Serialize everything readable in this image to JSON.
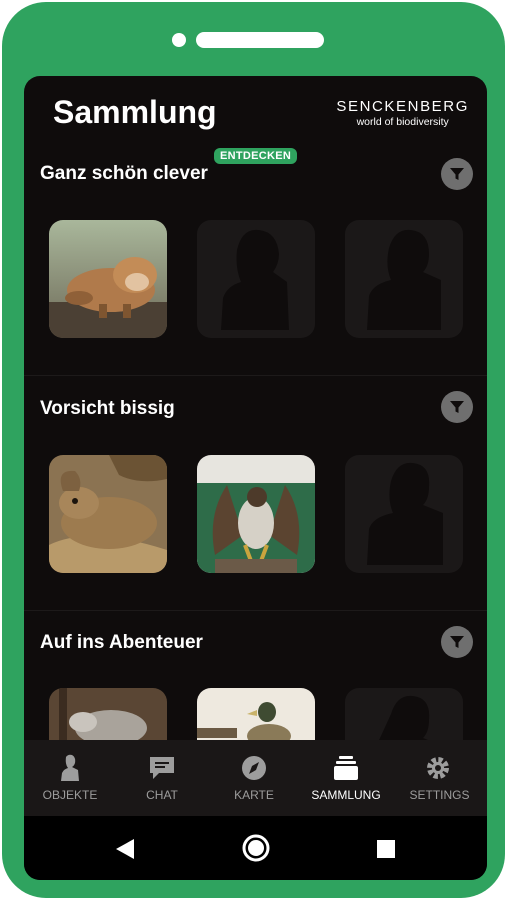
{
  "app": {
    "title": "Sammlung",
    "logo_main": "SENCKENBERG",
    "logo_sub": "world of biodiversity"
  },
  "sections": [
    {
      "title": "Ganz schön clever",
      "badge": "ENTDECKEN"
    },
    {
      "title": "Vorsicht bissig"
    },
    {
      "title": "Auf ins Abenteuer"
    }
  ],
  "nav": {
    "items": [
      {
        "label": "OBJEKTE",
        "icon": "person-icon"
      },
      {
        "label": "CHAT",
        "icon": "chat-icon"
      },
      {
        "label": "KARTE",
        "icon": "compass-icon"
      },
      {
        "label": "SAMMLUNG",
        "icon": "collection-icon"
      },
      {
        "label": "SETTINGS",
        "icon": "gear-icon"
      }
    ],
    "active": "SAMMLUNG"
  },
  "colors": {
    "accent": "#2fa35f",
    "screen_bg": "#0f0c0c",
    "placeholder": "#1b1818",
    "nav_bg": "#1a1717"
  }
}
